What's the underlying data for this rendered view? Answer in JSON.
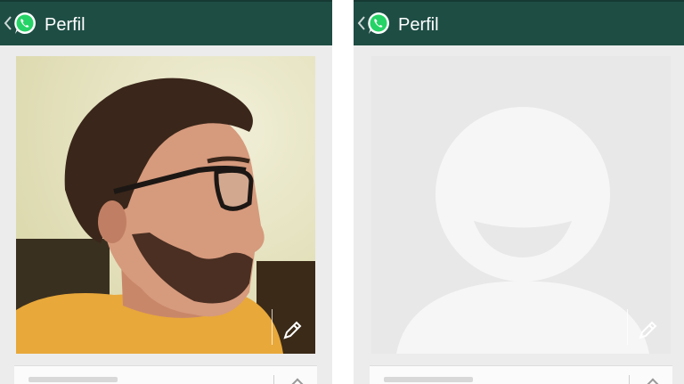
{
  "screens": [
    {
      "appbar": {
        "title": "Perfil",
        "logo": "whatsapp-icon",
        "back": "chevron-left-icon"
      },
      "photo": {
        "kind": "user-photo",
        "edit": "pencil-icon"
      }
    },
    {
      "appbar": {
        "title": "Perfil",
        "logo": "whatsapp-icon",
        "back": "chevron-left-icon"
      },
      "photo": {
        "kind": "default-avatar-placeholder",
        "edit": "pencil-icon"
      }
    }
  ],
  "colors": {
    "appbar": "#1e4d44",
    "whatsapp_green": "#25d366",
    "background": "#ececec",
    "placeholder_bg": "#e8e8e8",
    "placeholder_avatar": "#f6f6f6"
  }
}
